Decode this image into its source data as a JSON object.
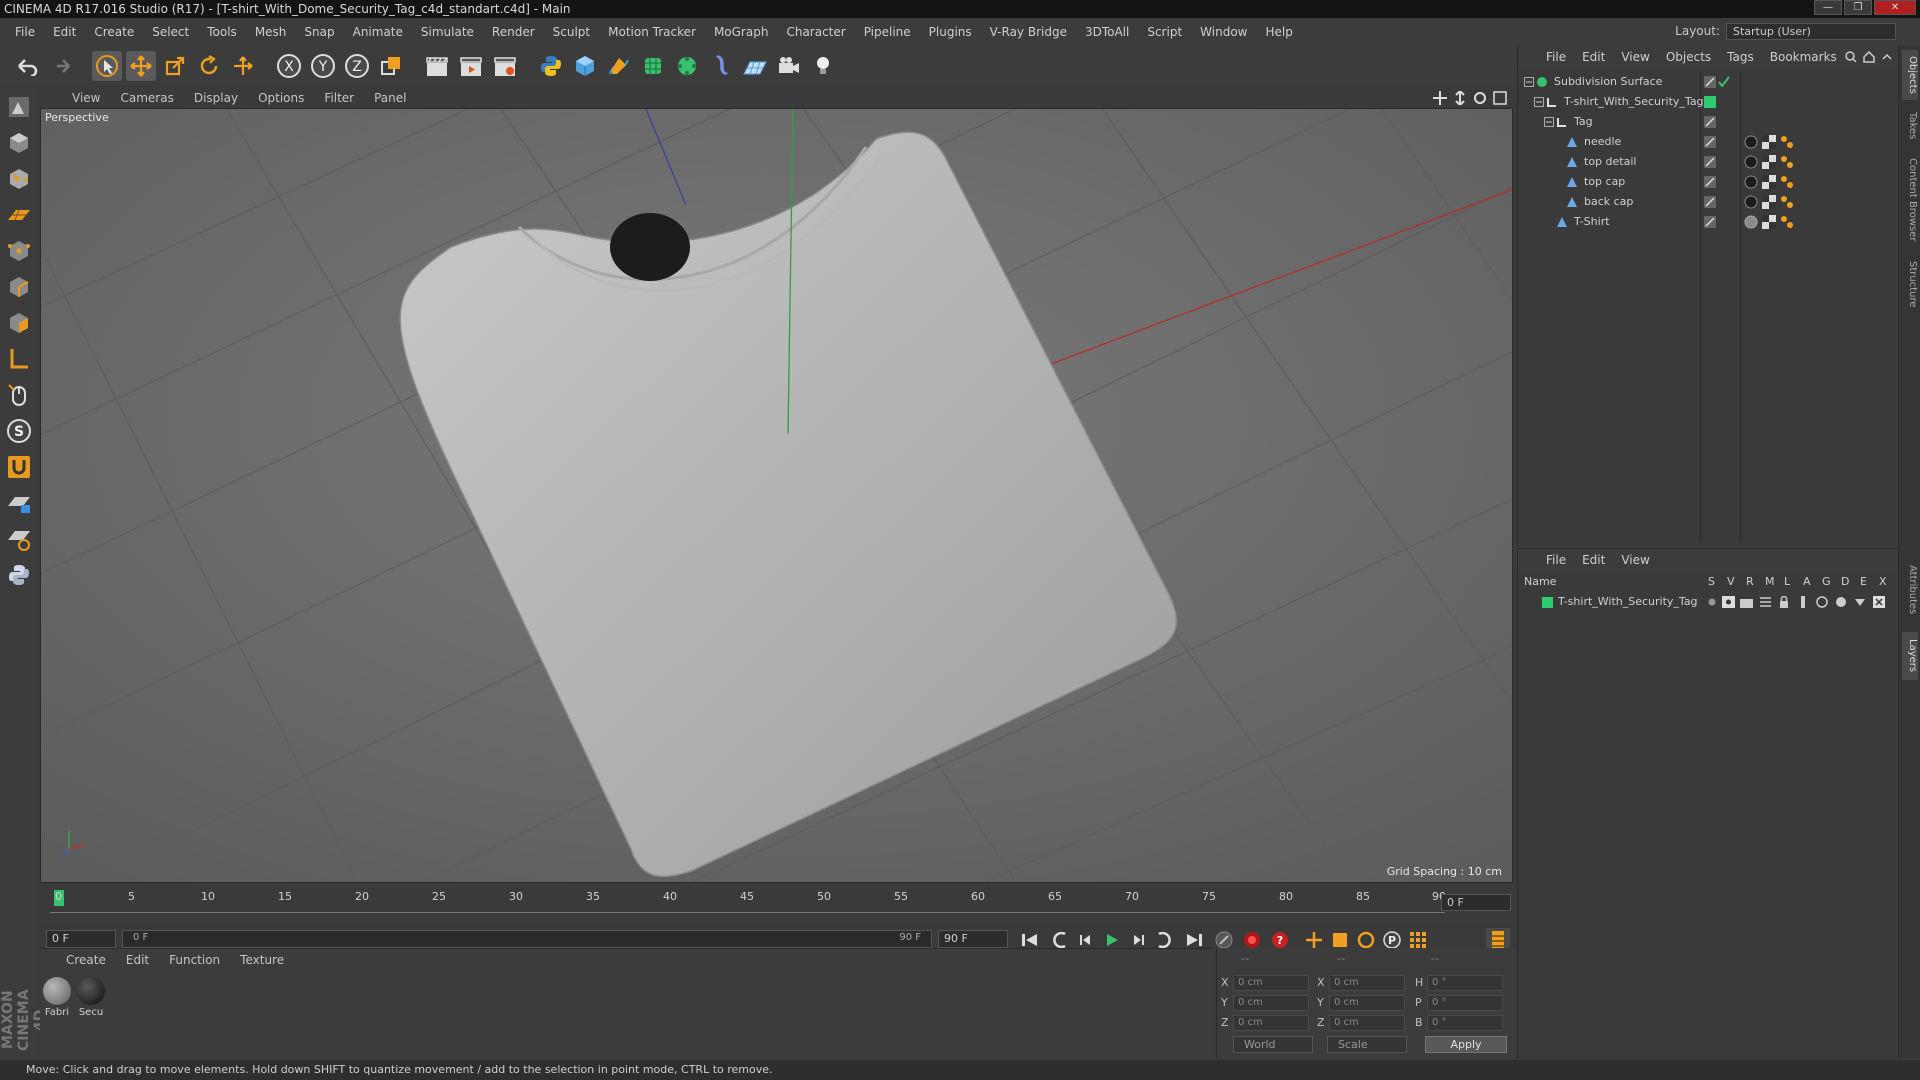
{
  "window": {
    "title": "CINEMA 4D R17.016 Studio (R17) - [T-shirt_With_Dome_Security_Tag_c4d_standart.c4d] - Main",
    "controls": [
      "—",
      "❐",
      "✕"
    ]
  },
  "menubar": {
    "items": [
      "File",
      "Edit",
      "Create",
      "Select",
      "Tools",
      "Mesh",
      "Snap",
      "Animate",
      "Simulate",
      "Render",
      "Sculpt",
      "Motion Tracker",
      "MoGraph",
      "Character",
      "Pipeline",
      "Plugins",
      "V-Ray Bridge",
      "3DToAll",
      "Script",
      "Window",
      "Help"
    ],
    "layout_label": "Layout:",
    "layout_value": "Startup (User)"
  },
  "toolbar": {
    "axis_x": "X",
    "axis_y": "Y",
    "axis_z": "Z"
  },
  "viewport": {
    "menu": [
      "View",
      "Cameras",
      "Display",
      "Options",
      "Filter",
      "Panel"
    ],
    "label": "Perspective",
    "grid_spacing": "Grid Spacing : 10 cm"
  },
  "timeline": {
    "ticks": [
      "0",
      "5",
      "10",
      "15",
      "20",
      "25",
      "30",
      "35",
      "40",
      "45",
      "50",
      "55",
      "60",
      "65",
      "70",
      "75",
      "80",
      "85",
      "90"
    ],
    "current_frame": "0 F"
  },
  "transport": {
    "start_frame": "0 F",
    "slider_start": "0 F",
    "slider_end": "90 F",
    "end_frame": "90 F"
  },
  "materials": {
    "menu": [
      "Create",
      "Edit",
      "Function",
      "Texture"
    ],
    "items": [
      {
        "label": "Fabri",
        "color": "#8a8a8a"
      },
      {
        "label": "Secu",
        "color": "#1a1a1a"
      }
    ]
  },
  "coordinates": {
    "headers": [
      "--",
      "--",
      "--"
    ],
    "rows": [
      {
        "l1": "X",
        "v1": "0 cm",
        "l2": "X",
        "v2": "0 cm",
        "l3": "H",
        "v3": "0 °"
      },
      {
        "l1": "Y",
        "v1": "0 cm",
        "l2": "Y",
        "v2": "0 cm",
        "l3": "P",
        "v3": "0 °"
      },
      {
        "l1": "Z",
        "v1": "0 cm",
        "l2": "Z",
        "v2": "0 cm",
        "l3": "B",
        "v3": "0 °"
      }
    ],
    "space": "World",
    "mode": "Scale",
    "apply": "Apply"
  },
  "objects": {
    "menu": [
      "File",
      "Edit",
      "View",
      "Objects",
      "Tags",
      "Bookmarks"
    ],
    "items": [
      {
        "name": "Subdivision Surface",
        "indent": 0
      },
      {
        "name": "T-shirt_With_Security_Tag",
        "indent": 1
      },
      {
        "name": "Tag",
        "indent": 2
      },
      {
        "name": "needle",
        "indent": 3
      },
      {
        "name": "top detail",
        "indent": 3
      },
      {
        "name": "top cap",
        "indent": 3
      },
      {
        "name": "back cap",
        "indent": 3
      },
      {
        "name": "T-Shirt",
        "indent": 2
      }
    ]
  },
  "layers": {
    "menu": [
      "File",
      "Edit",
      "View"
    ],
    "columns": [
      "Name",
      "S",
      "V",
      "R",
      "M",
      "L",
      "A",
      "G",
      "D",
      "E",
      "X"
    ],
    "rows": [
      {
        "name": "T-shirt_With_Security_Tag",
        "color": "#2ecc71"
      }
    ]
  },
  "side_tabs": [
    "Objects",
    "Takes",
    "Content Browser",
    "Structure",
    "Attributes",
    "Layers"
  ],
  "brand": "MAXON CINEMA 4D",
  "status": "Move: Click and drag to move elements. Hold down SHIFT to quantize movement / add to the selection in point mode, CTRL to remove."
}
